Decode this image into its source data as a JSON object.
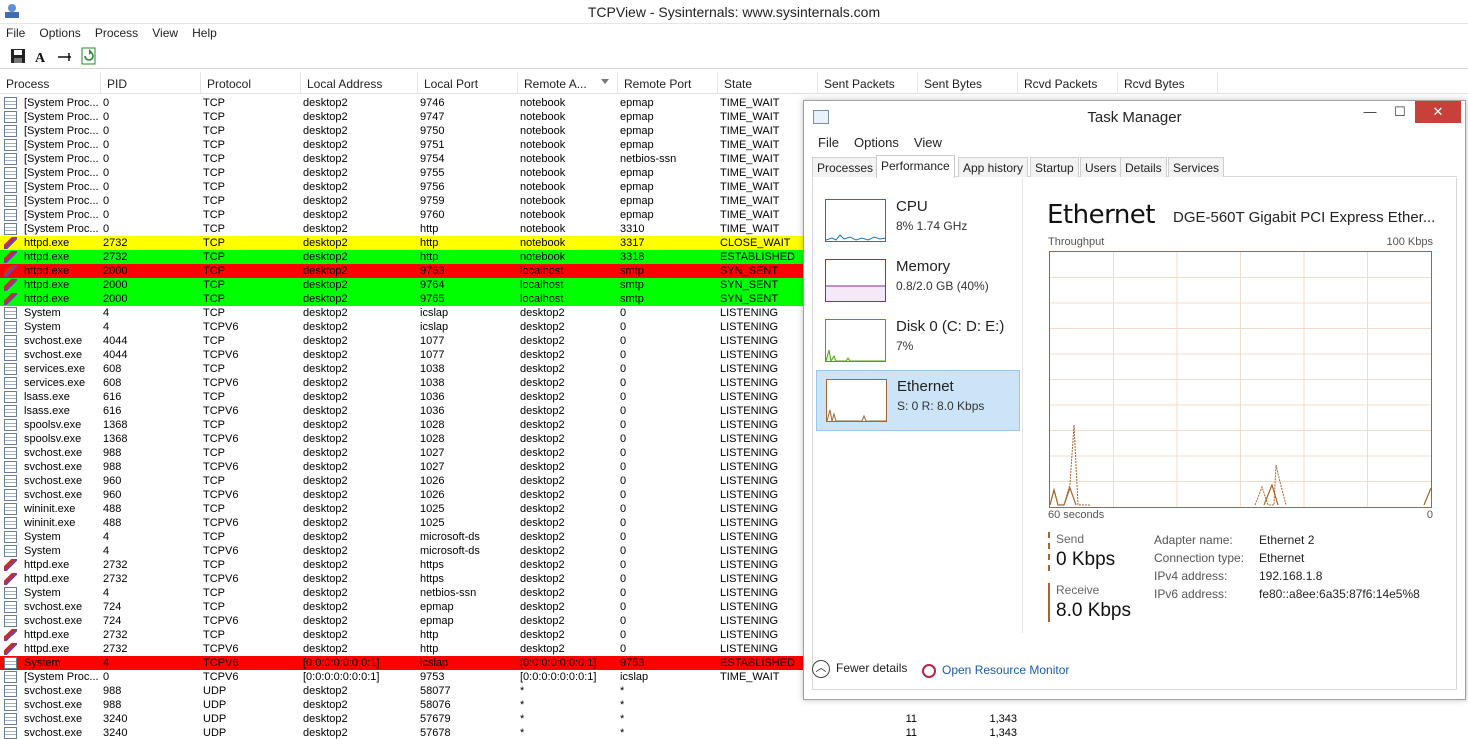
{
  "tcpview": {
    "title": "TCPView - Sysinternals: www.sysinternals.com",
    "menu": [
      "File",
      "Options",
      "Process",
      "View",
      "Help"
    ],
    "toolbar": [
      {
        "name": "save-icon",
        "glyph": "💾"
      },
      {
        "name": "font-icon",
        "glyph": "A"
      },
      {
        "name": "connect-icon",
        "glyph": "⊸"
      },
      {
        "name": "refresh-icon",
        "glyph": "⟳"
      }
    ],
    "columns": [
      "Process",
      "PID",
      "Protocol",
      "Local Address",
      "Local Port",
      "Remote A...",
      "Remote Port",
      "State",
      "Sent Packets",
      "Sent Bytes",
      "Rcvd Packets",
      "Rcvd Bytes"
    ],
    "colors": {
      "close_wait": "#ffff00",
      "established_new": "#00ff00",
      "closing": "#ff0000"
    },
    "rows": [
      {
        "icon": "sys",
        "process": "[System Proc...",
        "pid": "0",
        "proto": "TCP",
        "laddr": "desktop2",
        "lport": "9746",
        "raddr": "notebook",
        "rport": "epmap",
        "state": "TIME_WAIT",
        "hl": ""
      },
      {
        "icon": "sys",
        "process": "[System Proc...",
        "pid": "0",
        "proto": "TCP",
        "laddr": "desktop2",
        "lport": "9747",
        "raddr": "notebook",
        "rport": "epmap",
        "state": "TIME_WAIT",
        "hl": ""
      },
      {
        "icon": "sys",
        "process": "[System Proc...",
        "pid": "0",
        "proto": "TCP",
        "laddr": "desktop2",
        "lport": "9750",
        "raddr": "notebook",
        "rport": "epmap",
        "state": "TIME_WAIT",
        "hl": ""
      },
      {
        "icon": "sys",
        "process": "[System Proc...",
        "pid": "0",
        "proto": "TCP",
        "laddr": "desktop2",
        "lport": "9751",
        "raddr": "notebook",
        "rport": "epmap",
        "state": "TIME_WAIT",
        "hl": ""
      },
      {
        "icon": "sys",
        "process": "[System Proc...",
        "pid": "0",
        "proto": "TCP",
        "laddr": "desktop2",
        "lport": "9754",
        "raddr": "notebook",
        "rport": "netbios-ssn",
        "state": "TIME_WAIT",
        "hl": ""
      },
      {
        "icon": "sys",
        "process": "[System Proc...",
        "pid": "0",
        "proto": "TCP",
        "laddr": "desktop2",
        "lport": "9755",
        "raddr": "notebook",
        "rport": "epmap",
        "state": "TIME_WAIT",
        "hl": ""
      },
      {
        "icon": "sys",
        "process": "[System Proc...",
        "pid": "0",
        "proto": "TCP",
        "laddr": "desktop2",
        "lport": "9756",
        "raddr": "notebook",
        "rport": "epmap",
        "state": "TIME_WAIT",
        "hl": ""
      },
      {
        "icon": "sys",
        "process": "[System Proc...",
        "pid": "0",
        "proto": "TCP",
        "laddr": "desktop2",
        "lport": "9759",
        "raddr": "notebook",
        "rport": "epmap",
        "state": "TIME_WAIT",
        "hl": ""
      },
      {
        "icon": "sys",
        "process": "[System Proc...",
        "pid": "0",
        "proto": "TCP",
        "laddr": "desktop2",
        "lport": "9760",
        "raddr": "notebook",
        "rport": "epmap",
        "state": "TIME_WAIT",
        "hl": ""
      },
      {
        "icon": "sys",
        "process": "[System Proc...",
        "pid": "0",
        "proto": "TCP",
        "laddr": "desktop2",
        "lport": "http",
        "raddr": "notebook",
        "rport": "3310",
        "state": "TIME_WAIT",
        "hl": ""
      },
      {
        "icon": "feather",
        "process": "httpd.exe",
        "pid": "2732",
        "proto": "TCP",
        "laddr": "desktop2",
        "lport": "http",
        "raddr": "notebook",
        "rport": "3317",
        "state": "CLOSE_WAIT",
        "hl": "yellow"
      },
      {
        "icon": "feather",
        "process": "httpd.exe",
        "pid": "2732",
        "proto": "TCP",
        "laddr": "desktop2",
        "lport": "http",
        "raddr": "notebook",
        "rport": "3318",
        "state": "ESTABLISHED",
        "hl": "green"
      },
      {
        "icon": "feather",
        "process": "httpd.exe",
        "pid": "2000",
        "proto": "TCP",
        "laddr": "desktop2",
        "lport": "9763",
        "raddr": "localhost",
        "rport": "smtp",
        "state": "SYN_SENT",
        "hl": "red"
      },
      {
        "icon": "feather",
        "process": "httpd.exe",
        "pid": "2000",
        "proto": "TCP",
        "laddr": "desktop2",
        "lport": "9764",
        "raddr": "localhost",
        "rport": "smtp",
        "state": "SYN_SENT",
        "hl": "green"
      },
      {
        "icon": "feather",
        "process": "httpd.exe",
        "pid": "2000",
        "proto": "TCP",
        "laddr": "desktop2",
        "lport": "9765",
        "raddr": "localhost",
        "rport": "smtp",
        "state": "SYN_SENT",
        "hl": "green"
      },
      {
        "icon": "sys",
        "process": "System",
        "pid": "4",
        "proto": "TCP",
        "laddr": "desktop2",
        "lport": "icslap",
        "raddr": "desktop2",
        "rport": "0",
        "state": "LISTENING",
        "hl": ""
      },
      {
        "icon": "sys",
        "process": "System",
        "pid": "4",
        "proto": "TCPV6",
        "laddr": "desktop2",
        "lport": "icslap",
        "raddr": "desktop2",
        "rport": "0",
        "state": "LISTENING",
        "hl": ""
      },
      {
        "icon": "sys",
        "process": "svchost.exe",
        "pid": "4044",
        "proto": "TCP",
        "laddr": "desktop2",
        "lport": "1077",
        "raddr": "desktop2",
        "rport": "0",
        "state": "LISTENING",
        "hl": ""
      },
      {
        "icon": "sys",
        "process": "svchost.exe",
        "pid": "4044",
        "proto": "TCPV6",
        "laddr": "desktop2",
        "lport": "1077",
        "raddr": "desktop2",
        "rport": "0",
        "state": "LISTENING",
        "hl": ""
      },
      {
        "icon": "sys",
        "process": "services.exe",
        "pid": "608",
        "proto": "TCP",
        "laddr": "desktop2",
        "lport": "1038",
        "raddr": "desktop2",
        "rport": "0",
        "state": "LISTENING",
        "hl": ""
      },
      {
        "icon": "sys",
        "process": "services.exe",
        "pid": "608",
        "proto": "TCPV6",
        "laddr": "desktop2",
        "lport": "1038",
        "raddr": "desktop2",
        "rport": "0",
        "state": "LISTENING",
        "hl": ""
      },
      {
        "icon": "sys",
        "process": "lsass.exe",
        "pid": "616",
        "proto": "TCP",
        "laddr": "desktop2",
        "lport": "1036",
        "raddr": "desktop2",
        "rport": "0",
        "state": "LISTENING",
        "hl": ""
      },
      {
        "icon": "sys",
        "process": "lsass.exe",
        "pid": "616",
        "proto": "TCPV6",
        "laddr": "desktop2",
        "lport": "1036",
        "raddr": "desktop2",
        "rport": "0",
        "state": "LISTENING",
        "hl": ""
      },
      {
        "icon": "sys",
        "process": "spoolsv.exe",
        "pid": "1368",
        "proto": "TCP",
        "laddr": "desktop2",
        "lport": "1028",
        "raddr": "desktop2",
        "rport": "0",
        "state": "LISTENING",
        "hl": ""
      },
      {
        "icon": "sys",
        "process": "spoolsv.exe",
        "pid": "1368",
        "proto": "TCPV6",
        "laddr": "desktop2",
        "lport": "1028",
        "raddr": "desktop2",
        "rport": "0",
        "state": "LISTENING",
        "hl": ""
      },
      {
        "icon": "sys",
        "process": "svchost.exe",
        "pid": "988",
        "proto": "TCP",
        "laddr": "desktop2",
        "lport": "1027",
        "raddr": "desktop2",
        "rport": "0",
        "state": "LISTENING",
        "hl": ""
      },
      {
        "icon": "sys",
        "process": "svchost.exe",
        "pid": "988",
        "proto": "TCPV6",
        "laddr": "desktop2",
        "lport": "1027",
        "raddr": "desktop2",
        "rport": "0",
        "state": "LISTENING",
        "hl": ""
      },
      {
        "icon": "sys",
        "process": "svchost.exe",
        "pid": "960",
        "proto": "TCP",
        "laddr": "desktop2",
        "lport": "1026",
        "raddr": "desktop2",
        "rport": "0",
        "state": "LISTENING",
        "hl": ""
      },
      {
        "icon": "sys",
        "process": "svchost.exe",
        "pid": "960",
        "proto": "TCPV6",
        "laddr": "desktop2",
        "lport": "1026",
        "raddr": "desktop2",
        "rport": "0",
        "state": "LISTENING",
        "hl": ""
      },
      {
        "icon": "sys",
        "process": "wininit.exe",
        "pid": "488",
        "proto": "TCP",
        "laddr": "desktop2",
        "lport": "1025",
        "raddr": "desktop2",
        "rport": "0",
        "state": "LISTENING",
        "hl": ""
      },
      {
        "icon": "sys",
        "process": "wininit.exe",
        "pid": "488",
        "proto": "TCPV6",
        "laddr": "desktop2",
        "lport": "1025",
        "raddr": "desktop2",
        "rport": "0",
        "state": "LISTENING",
        "hl": ""
      },
      {
        "icon": "sys",
        "process": "System",
        "pid": "4",
        "proto": "TCP",
        "laddr": "desktop2",
        "lport": "microsoft-ds",
        "raddr": "desktop2",
        "rport": "0",
        "state": "LISTENING",
        "hl": ""
      },
      {
        "icon": "sys",
        "process": "System",
        "pid": "4",
        "proto": "TCPV6",
        "laddr": "desktop2",
        "lport": "microsoft-ds",
        "raddr": "desktop2",
        "rport": "0",
        "state": "LISTENING",
        "hl": ""
      },
      {
        "icon": "feather",
        "process": "httpd.exe",
        "pid": "2732",
        "proto": "TCP",
        "laddr": "desktop2",
        "lport": "https",
        "raddr": "desktop2",
        "rport": "0",
        "state": "LISTENING",
        "hl": ""
      },
      {
        "icon": "feather",
        "process": "httpd.exe",
        "pid": "2732",
        "proto": "TCPV6",
        "laddr": "desktop2",
        "lport": "https",
        "raddr": "desktop2",
        "rport": "0",
        "state": "LISTENING",
        "hl": ""
      },
      {
        "icon": "sys",
        "process": "System",
        "pid": "4",
        "proto": "TCP",
        "laddr": "desktop2",
        "lport": "netbios-ssn",
        "raddr": "desktop2",
        "rport": "0",
        "state": "LISTENING",
        "hl": ""
      },
      {
        "icon": "sys",
        "process": "svchost.exe",
        "pid": "724",
        "proto": "TCP",
        "laddr": "desktop2",
        "lport": "epmap",
        "raddr": "desktop2",
        "rport": "0",
        "state": "LISTENING",
        "hl": ""
      },
      {
        "icon": "sys",
        "process": "svchost.exe",
        "pid": "724",
        "proto": "TCPV6",
        "laddr": "desktop2",
        "lport": "epmap",
        "raddr": "desktop2",
        "rport": "0",
        "state": "LISTENING",
        "hl": ""
      },
      {
        "icon": "feather",
        "process": "httpd.exe",
        "pid": "2732",
        "proto": "TCP",
        "laddr": "desktop2",
        "lport": "http",
        "raddr": "desktop2",
        "rport": "0",
        "state": "LISTENING",
        "hl": ""
      },
      {
        "icon": "feather",
        "process": "httpd.exe",
        "pid": "2732",
        "proto": "TCPV6",
        "laddr": "desktop2",
        "lport": "http",
        "raddr": "desktop2",
        "rport": "0",
        "state": "LISTENING",
        "hl": ""
      },
      {
        "icon": "sys",
        "process": "System",
        "pid": "4",
        "proto": "TCPV6",
        "laddr": "[0:0:0:0:0:0:0:1]",
        "lport": "icslap",
        "raddr": "[0:0:0:0:0:0:0:1]",
        "rport": "9753",
        "state": "ESTABLISHED",
        "hl": "red"
      },
      {
        "icon": "sys",
        "process": "[System Proc...",
        "pid": "0",
        "proto": "TCPV6",
        "laddr": "[0:0:0:0:0:0:0:1]",
        "lport": "9753",
        "raddr": "[0:0:0:0:0:0:0:1]",
        "rport": "icslap",
        "state": "TIME_WAIT",
        "hl": ""
      },
      {
        "icon": "sys",
        "process": "svchost.exe",
        "pid": "988",
        "proto": "UDP",
        "laddr": "desktop2",
        "lport": "58077",
        "raddr": "*",
        "rport": "*",
        "state": "",
        "hl": ""
      },
      {
        "icon": "sys",
        "process": "svchost.exe",
        "pid": "988",
        "proto": "UDP",
        "laddr": "desktop2",
        "lport": "58076",
        "raddr": "*",
        "rport": "*",
        "state": "",
        "hl": ""
      },
      {
        "icon": "sys",
        "process": "svchost.exe",
        "pid": "3240",
        "proto": "UDP",
        "laddr": "desktop2",
        "lport": "57679",
        "raddr": "*",
        "rport": "*",
        "state": "",
        "hl": "",
        "sent_packets": "11",
        "sent_bytes": "1,343"
      },
      {
        "icon": "sys",
        "process": "svchost.exe",
        "pid": "3240",
        "proto": "UDP",
        "laddr": "desktop2",
        "lport": "57678",
        "raddr": "*",
        "rport": "*",
        "state": "",
        "hl": "",
        "sent_packets": "11",
        "sent_bytes": "1,343"
      }
    ]
  },
  "taskmanager": {
    "title": "Task Manager",
    "window_buttons": {
      "minimize": "—",
      "maximize": "☐",
      "close": "✕"
    },
    "menu": [
      "File",
      "Options",
      "View"
    ],
    "tabs": [
      "Processes",
      "Performance",
      "App history",
      "Startup",
      "Users",
      "Details",
      "Services"
    ],
    "active_tab": "Performance",
    "perf_items": [
      {
        "name": "CPU",
        "sub": "8%  1.74 GHz",
        "color": "#1779ba"
      },
      {
        "name": "Memory",
        "sub": "0.8/2.0 GB (40%)",
        "color": "#8b23a8"
      },
      {
        "name": "Disk 0 (C: D: E:)",
        "sub": "7%",
        "color": "#4da60c"
      },
      {
        "name": "Ethernet",
        "sub": "S: 0  R: 8.0 Kbps",
        "color": "#a7652b"
      }
    ],
    "ethernet": {
      "title": "Ethernet",
      "adapter": "DGE-560T Gigabit PCI Express Ether...",
      "throughput_label": "Throughput",
      "max_label": "100 Kbps",
      "time_label": "60 seconds",
      "zero_label": "0",
      "send_label": "Send",
      "send_value": "0 Kbps",
      "receive_label": "Receive",
      "receive_value": "8.0 Kbps",
      "details": [
        {
          "k": "Adapter name:",
          "v": "Ethernet 2"
        },
        {
          "k": "Connection type:",
          "v": "Ethernet"
        },
        {
          "k": "IPv4 address:",
          "v": "192.168.1.8"
        },
        {
          "k": "IPv6 address:",
          "v": "fe80::a8ee:6a35:87f6:14e5%8"
        }
      ],
      "graph_color": "#a7652b"
    },
    "footer": {
      "fewer_details": "Fewer details",
      "open_resource_monitor": "Open Resource Monitor"
    }
  }
}
